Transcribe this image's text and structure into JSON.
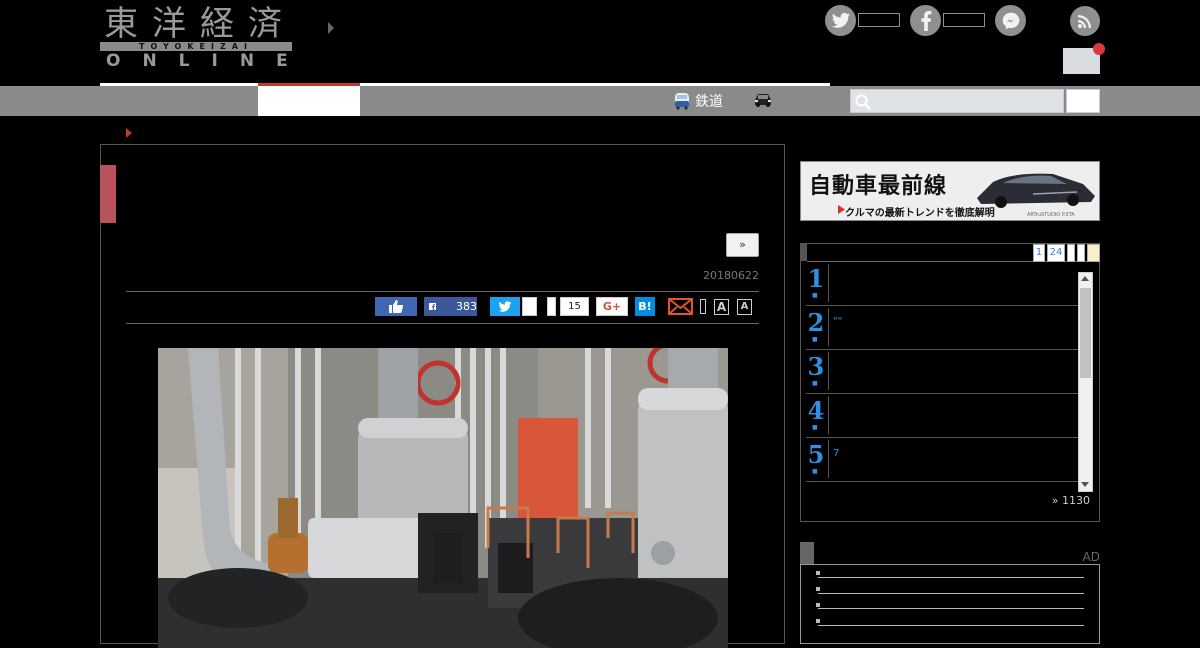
{
  "header": {
    "logo_kanji": "東洋経済",
    "logo_romaji": "TOYOKEIZAI",
    "logo_online": "ONLINE"
  },
  "nav": {
    "rail_label": "鉄道"
  },
  "article": {
    "more_label": "»",
    "date": "20180622",
    "share": {
      "facebook_count": "383",
      "pocket_count": "15",
      "googleplus_label": "G+",
      "hatena_label": "B!",
      "font_large": "A",
      "font_small": "A"
    }
  },
  "sidebar": {
    "banner": {
      "title": "自動車最前線",
      "subtitle": "クルマの最新トレンドを徹底解明",
      "credit": "ARTruSTUDIO P.IITA"
    },
    "ranking": {
      "tabs": [
        "1",
        "24"
      ],
      "items": [
        {
          "rank": "1",
          "text": ""
        },
        {
          "rank": "2",
          "text": "\"\""
        },
        {
          "rank": "3",
          "text": ""
        },
        {
          "rank": "4",
          "text": ""
        },
        {
          "rank": "5",
          "text": "7"
        }
      ],
      "more": "» 1130"
    },
    "ad_label": "AD"
  },
  "colors": {
    "accent_red": "#c0392b",
    "title_accent": "#b8525c",
    "rank_blue": "#2f8fe0",
    "facebook": "#3b5998",
    "twitter": "#1da1f2",
    "hatena": "#008fde"
  }
}
